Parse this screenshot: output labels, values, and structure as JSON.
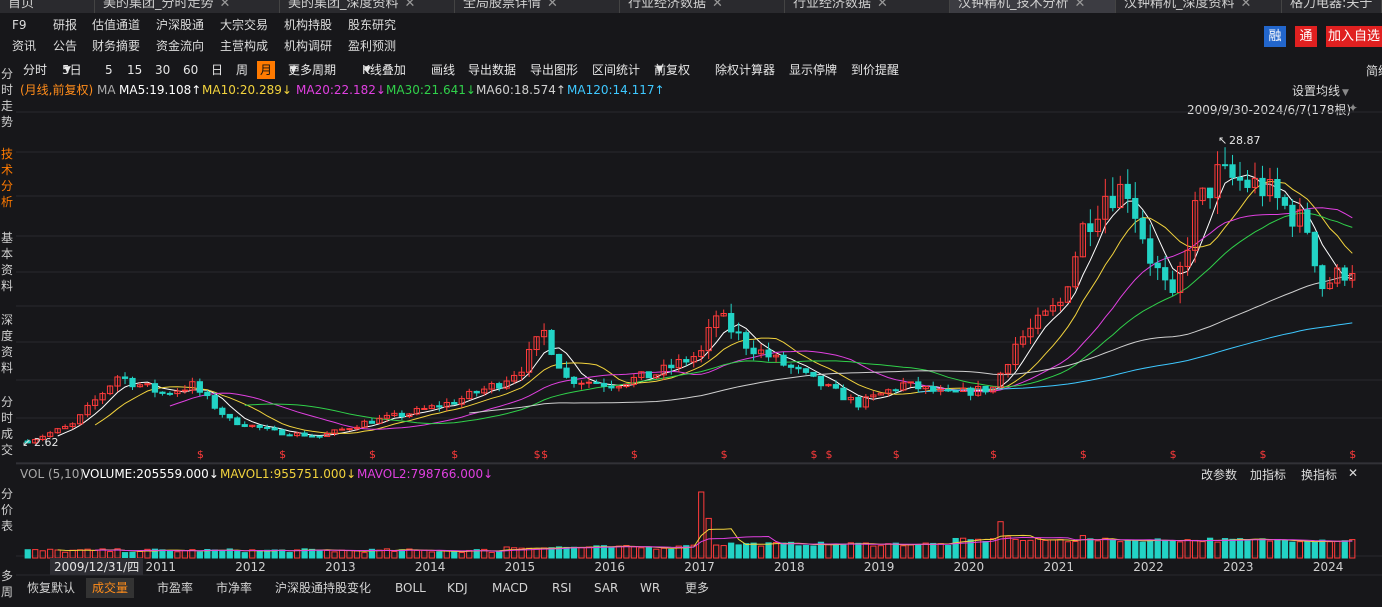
{
  "tabs": [
    {
      "label": "首页"
    },
    {
      "label": "美的集团_分时走势"
    },
    {
      "label": "美的集团_深度资料"
    },
    {
      "label": "全局股票详情"
    },
    {
      "label": "行业经济数据"
    },
    {
      "label": "行业经济数据"
    },
    {
      "label": "汉钟精机_技术分析"
    },
    {
      "label": "汉钟精机_深度资料"
    },
    {
      "label": "格力电器:关于"
    }
  ],
  "nav_row1": [
    "F9",
    "研报",
    "估值通道",
    "沪深股通",
    "大宗交易",
    "机构持股",
    "股东研究"
  ],
  "nav_row2": [
    "资讯",
    "公告",
    "财务摘要",
    "资金流向",
    "主营构成",
    "机构调研",
    "盈利预测"
  ],
  "badges": {
    "rong": "融",
    "tong": "通",
    "add": "加入自选"
  },
  "toolbar": [
    "分时",
    "5日",
    "5",
    "15",
    "30",
    "60",
    "日",
    "周",
    "月",
    "更多周期",
    "K线叠加",
    "画线",
    "导出数据",
    "导出图形",
    "区间统计",
    "前复权",
    "除权计算器",
    "显示停牌",
    "到价提醒"
  ],
  "right_edge_label": "简缩",
  "sidebar": [
    "分时走势",
    "技术分析",
    "基本资料",
    "深度资料",
    "分时成交",
    "分价表",
    "多周"
  ],
  "ma_legend": {
    "mode": "(月线,前复权)",
    "ma": "MA",
    "ma5": "MA5:19.108↑",
    "ma10": "MA10:20.289↓",
    "ma20": "MA20:22.182↓",
    "ma30": "MA30:21.641↓",
    "ma60": "MA60:18.574↑",
    "ma120": "MA120:14.117↑"
  },
  "chart_tools": {
    "set_ma": "设置均线",
    "range": "2009/9/30-2024/6/7(178根)"
  },
  "annotations": {
    "high": "28.87",
    "low": "2.62"
  },
  "dividend_marker": "$",
  "vol_legend": {
    "label": "VOL (5,10)",
    "volume": "VOLUME:205559.000↓",
    "mavol1": "MAVOL1:955751.000↓",
    "mavol2": "MAVOL2:798766.000↓"
  },
  "vol_tools": [
    "改参数",
    "加指标",
    "换指标"
  ],
  "x_axis": {
    "cursor_date": "2009/12/31/四",
    "years": [
      "2011",
      "2012",
      "2013",
      "2014",
      "2015",
      "2016",
      "2017",
      "2018",
      "2019",
      "2020",
      "2021",
      "2022",
      "2023",
      "2024"
    ]
  },
  "bottom_tabs": [
    "恢复默认",
    "成交量",
    "市盈率",
    "市净率",
    "沪深股通持股变化",
    "BOLL",
    "KDJ",
    "MACD",
    "RSI",
    "SAR",
    "WR",
    "更多"
  ],
  "colors": {
    "up": "#ff3b3b",
    "down": "#22d3c5",
    "accent": "#ff7a00",
    "ma5": "#ffffff",
    "ma10": "#f2d33d",
    "ma20": "#e040e0",
    "ma30": "#30d04a",
    "ma60": "#cfcfcf",
    "ma120": "#3ec8ff"
  },
  "chart_data": {
    "type": "candlestick",
    "period": "monthly",
    "y_range": [
      2.0,
      31.0
    ],
    "anchors": [
      [
        "2009-09",
        2.6
      ],
      [
        "2010-03",
        4.0
      ],
      [
        "2010-09",
        8.2
      ],
      [
        "2011-03",
        6.7
      ],
      [
        "2011-07",
        7.4
      ],
      [
        "2011-12",
        4.4
      ],
      [
        "2012-06",
        3.4
      ],
      [
        "2012-12",
        3.0
      ],
      [
        "2013-06",
        4.2
      ],
      [
        "2013-12",
        5.0
      ],
      [
        "2014-06",
        6.0
      ],
      [
        "2014-12",
        7.6
      ],
      [
        "2015-03",
        9.0
      ],
      [
        "2015-06",
        12.0
      ],
      [
        "2015-09",
        8.0
      ],
      [
        "2016-03",
        7.5
      ],
      [
        "2016-09",
        8.4
      ],
      [
        "2017-03",
        10.2
      ],
      [
        "2017-05",
        13.5
      ],
      [
        "2017-09",
        11.0
      ],
      [
        "2018-06",
        7.8
      ],
      [
        "2018-12",
        5.8
      ],
      [
        "2019-06",
        7.5
      ],
      [
        "2019-12",
        6.6
      ],
      [
        "2020-06",
        7.2
      ],
      [
        "2020-09",
        11.0
      ],
      [
        "2021-03",
        14.5
      ],
      [
        "2021-06",
        21.0
      ],
      [
        "2021-09",
        24.0
      ],
      [
        "2021-12",
        24.5
      ],
      [
        "2022-03",
        18.5
      ],
      [
        "2022-06",
        14.6
      ],
      [
        "2022-09",
        22.5
      ],
      [
        "2022-12",
        25.5
      ],
      [
        "2023-06",
        24.5
      ],
      [
        "2023-12",
        21.0
      ],
      [
        "2024-02",
        16.0
      ],
      [
        "2024-06",
        17.7
      ]
    ],
    "dividend_months": [
      "2011-08",
      "2012-07",
      "2013-07",
      "2014-06",
      "2015-05",
      "2015-06",
      "2016-06",
      "2017-06",
      "2018-06",
      "2018-08",
      "2019-05",
      "2020-06",
      "2021-06",
      "2022-06",
      "2023-06",
      "2024-06"
    ]
  }
}
